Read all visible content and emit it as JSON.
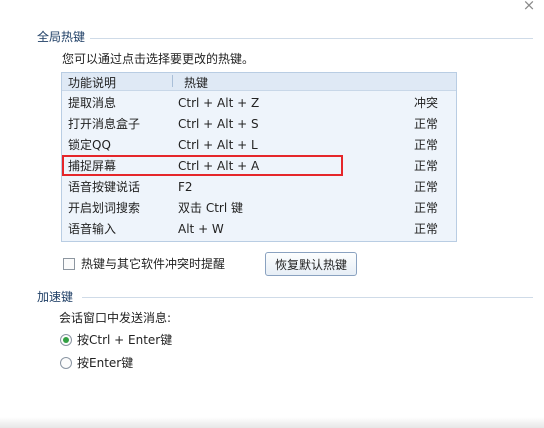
{
  "close_glyph": "×",
  "global_section": {
    "title": "全局热键"
  },
  "hint": "您可以通过点击选择要更改的热键。",
  "table": {
    "headers": {
      "function": "功能说明",
      "hotkey": "热键"
    },
    "rows": [
      {
        "name": "提取消息",
        "key": "Ctrl + Alt + Z",
        "status": "冲突"
      },
      {
        "name": "打开消息盒子",
        "key": "Ctrl + Alt + S",
        "status": "正常"
      },
      {
        "name": "锁定QQ",
        "key": "Ctrl + Alt + L",
        "status": "正常"
      },
      {
        "name": "捕捉屏幕",
        "key": "Ctrl + Alt + A",
        "status": "正常"
      },
      {
        "name": "语音按键说话",
        "key": "F2",
        "status": "正常"
      },
      {
        "name": "开启划词搜索",
        "key": "双击 Ctrl 键",
        "status": "正常"
      },
      {
        "name": "语音输入",
        "key": "Alt + W",
        "status": "正常"
      }
    ]
  },
  "conflict_checkbox": {
    "label": "热键与其它软件冲突时提醒",
    "checked": false
  },
  "restore_button": "恢复默认热键",
  "accel_section": {
    "title": "加速键"
  },
  "send_label": "会话窗口中发送消息:",
  "send_options": [
    {
      "label": "按Ctrl + Enter键",
      "selected": true
    },
    {
      "label": "按Enter键",
      "selected": false
    }
  ],
  "colors": {
    "highlight_border": "#e5262a",
    "radio_selected": "#32a042",
    "section_title": "#1f3f66"
  }
}
